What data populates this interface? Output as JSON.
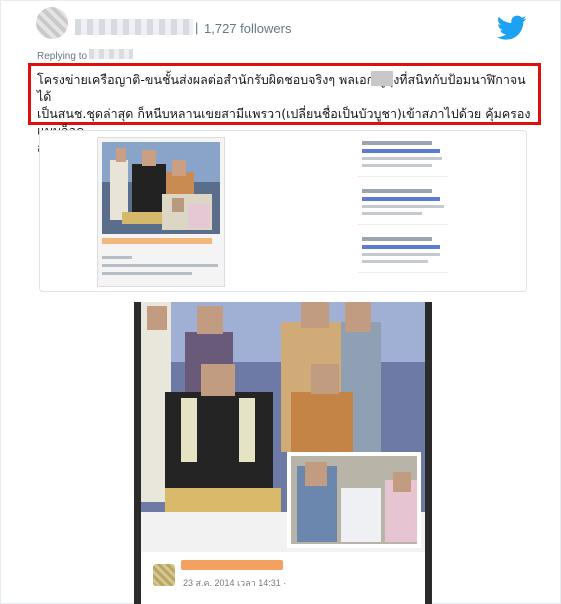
{
  "header": {
    "separator": "|",
    "followers": "1,727 followers",
    "brand_color": "#1da1f2"
  },
  "reply": {
    "label": "Replying to"
  },
  "tweet": {
    "text": "โครงข่ายเครือญาติ-ขนชั้นส่งผลต่อสำนักรับผิดชอบจริงๆ พลเอก    ผู้ลุงที่สนิทกับป้อมนาฬิกาจนได้\nเป็นสนช.ชุดล่าสุด ก็หนีบหลานเขยสามีแพรวา(เปลี่ยนชื่อเป็นบัวบูชา)เข้าสภาไปด้วย คุ้มครองแบบล็อค\nสามชั้น",
    "highlight_color": "#e10e0e"
  },
  "main_photo": {
    "date": "23 ส.ค. 2014 เวลา 14:31 ·"
  },
  "icons": {
    "brand": "twitter-bird-icon",
    "world": "globe-icon"
  }
}
